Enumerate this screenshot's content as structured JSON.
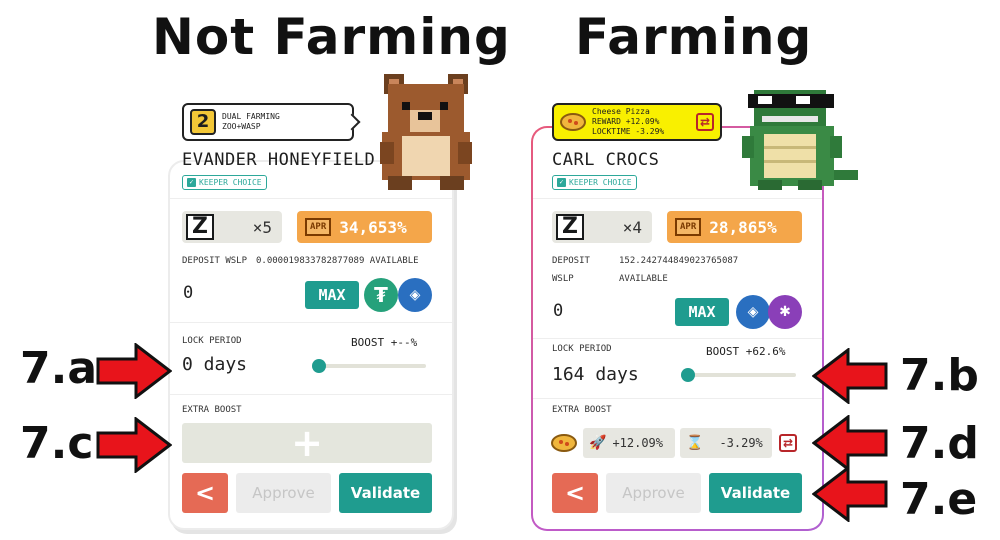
{
  "headings": {
    "left": "Not Farming",
    "right": "Farming"
  },
  "left_card": {
    "badge_line1": "DUAL FARMING",
    "badge_line2": "ZOO+WASP",
    "name": "EVANDER HONEYFIELD",
    "keeper": "KEEPER CHOICE",
    "multiplier": "×5",
    "apr_tag": "APR",
    "apr": "34,653%",
    "deposit_label": "DEPOSIT WSLP",
    "deposit_available": "0.000019833782877089 AVAILABLE",
    "deposit_value": "0",
    "max": "MAX",
    "lock_label": "LOCK PERIOD",
    "boost_label": "BOOST +--%",
    "lock_value": "0 days",
    "slider_fraction": 0.0,
    "extra_boost": "EXTRA BOOST",
    "add_symbol": "+",
    "back": "<",
    "approve": "Approve",
    "validate": "Validate"
  },
  "right_card": {
    "badge_line1": "Cheese Pizza",
    "badge_line2": "REWARD +12.09%",
    "badge_line3": "LOCKTIME -3.29%",
    "name": "CARL CROCS",
    "keeper": "KEEPER CHOICE",
    "multiplier": "×4",
    "apr_tag": "APR",
    "apr": "28,865%",
    "deposit_label": "DEPOSIT",
    "deposit_label2": "WSLP",
    "deposit_available": "152.242744849023765087",
    "deposit_available2": "AVAILABLE",
    "deposit_value": "0",
    "max": "MAX",
    "lock_label": "LOCK PERIOD",
    "boost_label": "BOOST +62.6%",
    "lock_value": "164 days",
    "slider_fraction": 0.03,
    "extra_boost": "EXTRA BOOST",
    "reward_boost": "+12.09%",
    "locktime_boost": "-3.29%",
    "back": "<",
    "approve": "Approve",
    "validate": "Validate"
  },
  "annotations": {
    "a": "7.a",
    "b": "7.b",
    "c": "7.c",
    "d": "7.d",
    "e": "7.e"
  },
  "colors": {
    "teal": "#1f9c8f",
    "orange": "#f4a64a",
    "arrow_red": "#e8141b",
    "back_red": "#e56a55"
  }
}
